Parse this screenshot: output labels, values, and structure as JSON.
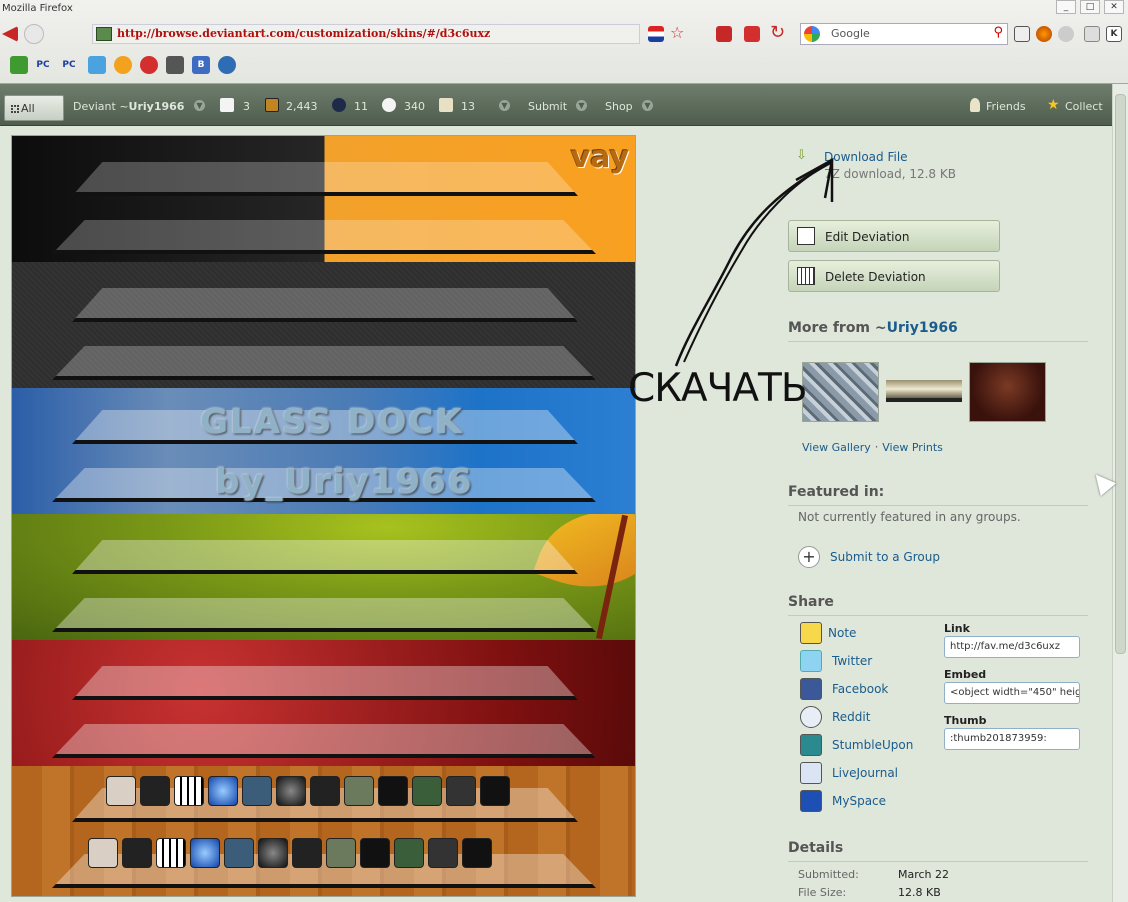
{
  "browser": {
    "window_title": "Mozilla Firefox",
    "window_buttons": [
      "_",
      "□",
      "✕"
    ],
    "url": "http://browse.deviantart.com/customization/skins/#/d3c6uxz",
    "search_engine": "Google",
    "search_placeholder": "Google",
    "bookmarks": [
      "PC",
      "PC",
      "B"
    ]
  },
  "dabar": {
    "all_label": "All",
    "deviant_prefix": "Deviant ~",
    "username": "Uriy1966",
    "stats": [
      {
        "name": "deviations",
        "value": "3"
      },
      {
        "name": "favourites",
        "value": "2,443"
      },
      {
        "name": "watch",
        "value": "11"
      },
      {
        "name": "comments",
        "value": "340"
      },
      {
        "name": "notices",
        "value": "13"
      }
    ],
    "submit": "Submit",
    "shop": "Shop",
    "friends": "Friends",
    "collect": "Collect"
  },
  "artwork": {
    "top_text": "vay",
    "title_line1": "GLASS DOCK",
    "title_line2": "by_Uriy1966"
  },
  "download": {
    "label": "Download File",
    "sub": "7Z download, 12.8 KB"
  },
  "actions": {
    "edit": "Edit Deviation",
    "delete": "Delete Deviation"
  },
  "more_from": {
    "heading_prefix": "More from ~",
    "username": "Uriy1966",
    "view_gallery": "View Gallery",
    "separator": "·",
    "view_prints": "View Prints"
  },
  "featured": {
    "heading": "Featured in:",
    "note": "Not currently featured in any groups.",
    "submit_group": "Submit to a Group"
  },
  "share": {
    "heading": "Share",
    "services": [
      "Note",
      "Twitter",
      "Facebook",
      "Reddit",
      "StumbleUpon",
      "LiveJournal",
      "MySpace"
    ],
    "link_label": "Link",
    "link_value": "http://fav.me/d3c6uxz",
    "embed_label": "Embed",
    "embed_value": "<object width=\"450\" heig",
    "thumb_label": "Thumb",
    "thumb_value": ":thumb201873959:"
  },
  "details": {
    "heading": "Details",
    "submitted_label": "Submitted:",
    "submitted_value": "March 22",
    "filesize_label": "File Size:",
    "filesize_value": "12.8 KB"
  },
  "annotation": {
    "text": "СКАЧАТЬ"
  },
  "colors": {
    "page_bg": "#dfe6da",
    "link": "#1a5c8c",
    "url_text": "#b10f0f",
    "dabar": "#5f6e5e"
  }
}
